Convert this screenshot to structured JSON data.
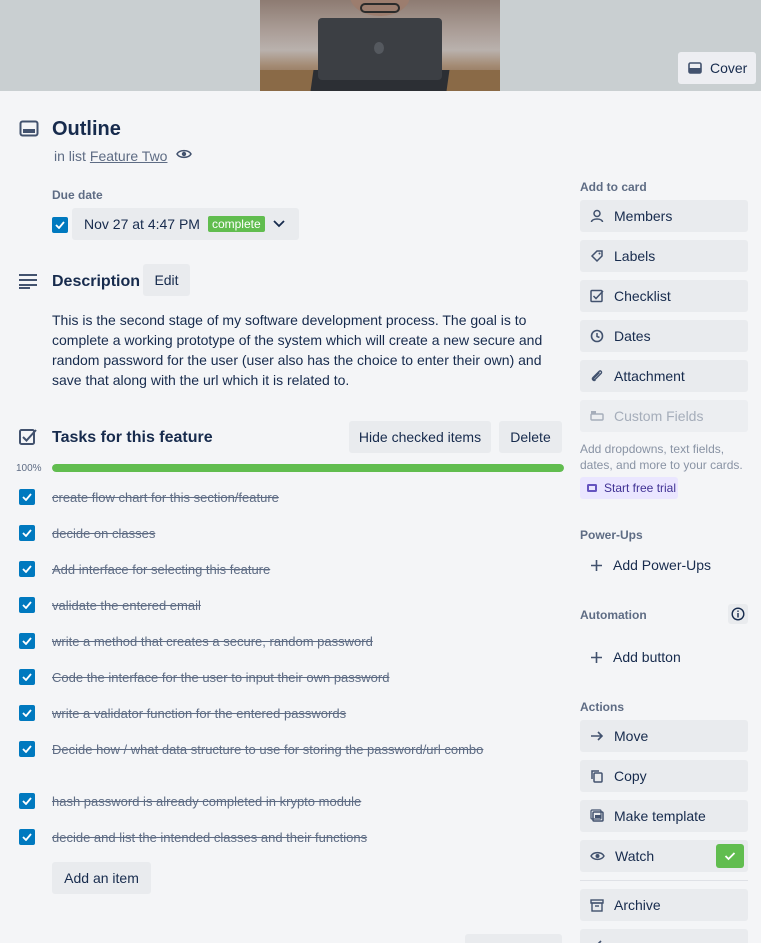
{
  "cover": {
    "button_label": "Cover"
  },
  "card": {
    "title": "Outline",
    "in_list_prefix": "in list",
    "list_name": "Feature Two"
  },
  "due_date": {
    "label": "Due date",
    "value": "Nov 27 at 4:47 PM",
    "status": "complete",
    "checked": true
  },
  "description": {
    "title": "Description",
    "edit_label": "Edit",
    "text": "This is the second stage of my software development process. The goal is to complete a working prototype of the system which will create a new secure and random password for the user (user also has the choice to enter their own) and save that along with the url which it is related to."
  },
  "checklist": {
    "title": "Tasks for this feature",
    "hide_label": "Hide checked items",
    "delete_label": "Delete",
    "progress_text": "100%",
    "progress_fraction": 1.0,
    "items": [
      {
        "text": "create flow chart for this section/feature",
        "checked": true
      },
      {
        "text": "decide on classes",
        "checked": true
      },
      {
        "text": "Add interface for selecting this feature",
        "checked": true
      },
      {
        "text": "validate the entered email",
        "checked": true
      },
      {
        "text": "write a method that creates a secure, random password",
        "checked": true
      },
      {
        "text": "Code the interface for the user to input their own password",
        "checked": true
      },
      {
        "text": "write a validator function for the entered passwords",
        "checked": true
      },
      {
        "text": "Decide how / what data structure to use for storing the password/url combo",
        "checked": true
      },
      {
        "text": "hash password is already completed in krypto module",
        "checked": true
      },
      {
        "text": "decide and list the intended classes and their functions",
        "checked": true
      }
    ],
    "add_item_label": "Add an item"
  },
  "sidebar": {
    "add_to_card": {
      "label": "Add to card",
      "buttons": [
        {
          "label": "Members",
          "icon": "person-icon"
        },
        {
          "label": "Labels",
          "icon": "tag-icon"
        },
        {
          "label": "Checklist",
          "icon": "checklist-icon"
        },
        {
          "label": "Dates",
          "icon": "clock-icon"
        },
        {
          "label": "Attachment",
          "icon": "paperclip-icon"
        },
        {
          "label": "Custom Fields",
          "icon": "custom-fields-icon"
        }
      ],
      "hint": "Add dropdowns, text fields, dates, and more to your cards.",
      "trial_label": "Start free trial"
    },
    "power_ups": {
      "label": "Power-Ups",
      "add_label": "Add Power-Ups"
    },
    "automation": {
      "label": "Automation",
      "add_button_label": "Add button"
    },
    "actions": {
      "label": "Actions",
      "buttons": [
        {
          "label": "Move",
          "icon": "arrow-right-icon"
        },
        {
          "label": "Copy",
          "icon": "copy-icon"
        },
        {
          "label": "Make template",
          "icon": "template-icon"
        },
        {
          "label": "Watch",
          "icon": "eye-icon"
        },
        {
          "label": "Archive",
          "icon": "archive-icon"
        }
      ]
    }
  },
  "colors": {
    "accent_blue": "#0079bf",
    "success_green": "#61bd4f",
    "trial_purple": "#403294"
  }
}
